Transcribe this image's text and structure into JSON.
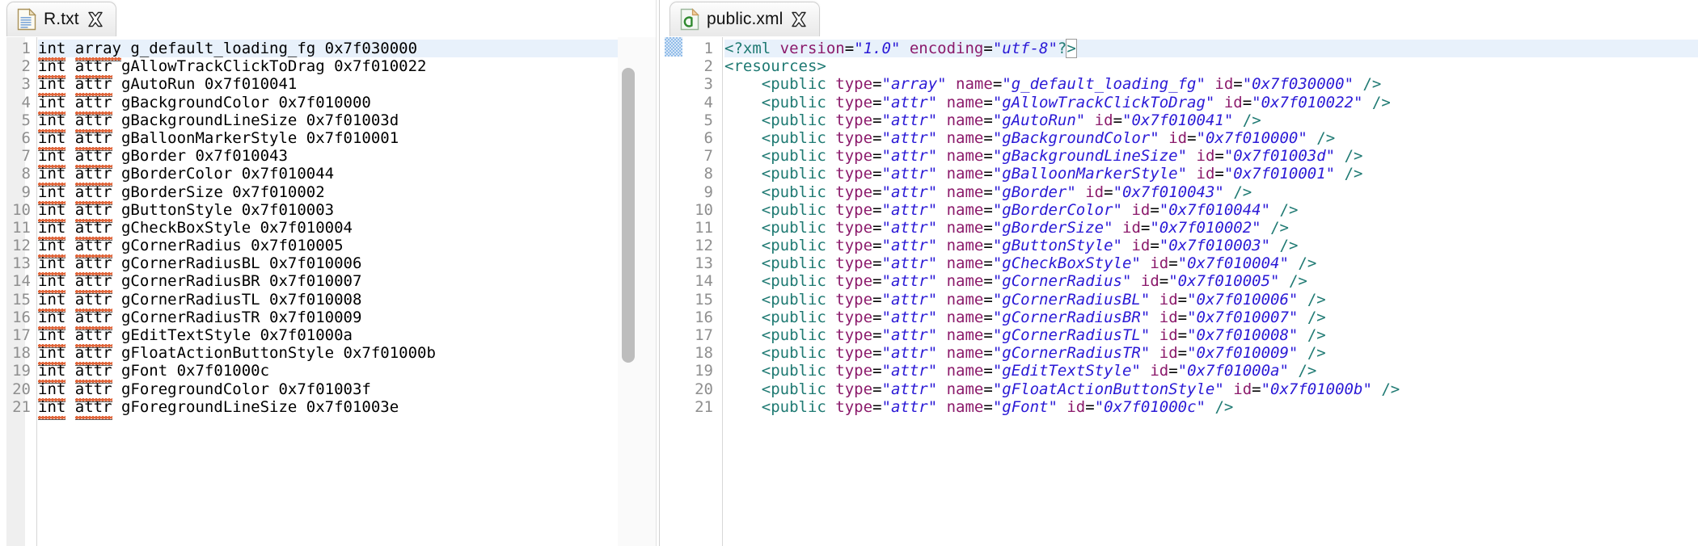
{
  "window": {
    "title": "Eclipse Editor Split View",
    "colors": {
      "tab_bg": "#f0f0f0",
      "current_line": "#e8f1fb",
      "linenumber": "#8f8f8f",
      "xml_tag": "#1f7a73",
      "xml_attr": "#8b1a6b",
      "xml_value": "#2a19d6",
      "spellcheck_underline": "#e0653a",
      "scrollbar_thumb": "#bdbdbd",
      "annotation_marker": "#7fb2e5"
    }
  },
  "left_pane": {
    "tab": {
      "label": "R.txt",
      "icon": "text-file-icon",
      "close_icon": "close-icon",
      "active": true
    },
    "scrollbar": {
      "thumb_top_pct": 6,
      "thumb_height_pct": 58
    },
    "first_line_number": 1,
    "last_line_number": 21,
    "current_line": 1,
    "lines": [
      {
        "n": 1,
        "type": "array",
        "name": "g_default_loading_fg",
        "id": "0x7f030000",
        "spell": [
          "int"
        ],
        "text": "int array g_default_loading_fg 0x7f030000"
      },
      {
        "n": 2,
        "type": "attr",
        "name": "gAllowTrackClickToDrag",
        "id": "0x7f010022",
        "spell": [
          "int",
          "attr"
        ],
        "text": "int attr gAllowTrackClickToDrag 0x7f010022"
      },
      {
        "n": 3,
        "type": "attr",
        "name": "gAutoRun",
        "id": "0x7f010041",
        "spell": [
          "int",
          "attr"
        ],
        "text": "int attr gAutoRun 0x7f010041"
      },
      {
        "n": 4,
        "type": "attr",
        "name": "gBackgroundColor",
        "id": "0x7f010000",
        "spell": [
          "int",
          "attr"
        ],
        "text": "int attr gBackgroundColor 0x7f010000"
      },
      {
        "n": 5,
        "type": "attr",
        "name": "gBackgroundLineSize",
        "id": "0x7f01003d",
        "spell": [
          "int",
          "attr"
        ],
        "text": "int attr gBackgroundLineSize 0x7f01003d"
      },
      {
        "n": 6,
        "type": "attr",
        "name": "gBalloonMarkerStyle",
        "id": "0x7f010001",
        "spell": [
          "int",
          "attr"
        ],
        "text": "int attr gBalloonMarkerStyle 0x7f010001"
      },
      {
        "n": 7,
        "type": "attr",
        "name": "gBorder",
        "id": "0x7f010043",
        "spell": [
          "int",
          "attr"
        ],
        "text": "int attr gBorder 0x7f010043"
      },
      {
        "n": 8,
        "type": "attr",
        "name": "gBorderColor",
        "id": "0x7f010044",
        "spell": [
          "int",
          "attr"
        ],
        "text": "int attr gBorderColor 0x7f010044"
      },
      {
        "n": 9,
        "type": "attr",
        "name": "gBorderSize",
        "id": "0x7f010002",
        "spell": [
          "int",
          "attr"
        ],
        "text": "int attr gBorderSize 0x7f010002"
      },
      {
        "n": 10,
        "type": "attr",
        "name": "gButtonStyle",
        "id": "0x7f010003",
        "spell": [
          "int",
          "attr"
        ],
        "text": "int attr gButtonStyle 0x7f010003"
      },
      {
        "n": 11,
        "type": "attr",
        "name": "gCheckBoxStyle",
        "id": "0x7f010004",
        "spell": [
          "int",
          "attr"
        ],
        "text": "int attr gCheckBoxStyle 0x7f010004"
      },
      {
        "n": 12,
        "type": "attr",
        "name": "gCornerRadius",
        "id": "0x7f010005",
        "spell": [
          "int",
          "attr"
        ],
        "text": "int attr gCornerRadius 0x7f010005"
      },
      {
        "n": 13,
        "type": "attr",
        "name": "gCornerRadiusBL",
        "id": "0x7f010006",
        "spell": [
          "int",
          "attr"
        ],
        "text": "int attr gCornerRadiusBL 0x7f010006"
      },
      {
        "n": 14,
        "type": "attr",
        "name": "gCornerRadiusBR",
        "id": "0x7f010007",
        "spell": [
          "int",
          "attr"
        ],
        "text": "int attr gCornerRadiusBR 0x7f010007"
      },
      {
        "n": 15,
        "type": "attr",
        "name": "gCornerRadiusTL",
        "id": "0x7f010008",
        "spell": [
          "int",
          "attr"
        ],
        "text": "int attr gCornerRadiusTL 0x7f010008"
      },
      {
        "n": 16,
        "type": "attr",
        "name": "gCornerRadiusTR",
        "id": "0x7f010009",
        "spell": [
          "int",
          "attr"
        ],
        "text": "int attr gCornerRadiusTR 0x7f010009"
      },
      {
        "n": 17,
        "type": "attr",
        "name": "gEditTextStyle",
        "id": "0x7f01000a",
        "spell": [
          "int",
          "attr"
        ],
        "text": "int attr gEditTextStyle 0x7f01000a"
      },
      {
        "n": 18,
        "type": "attr",
        "name": "gFloatActionButtonStyle",
        "id": "0x7f01000b",
        "spell": [
          "int",
          "attr"
        ],
        "text": "int attr gFloatActionButtonStyle 0x7f01000b"
      },
      {
        "n": 19,
        "type": "attr",
        "name": "gFont",
        "id": "0x7f01000c",
        "spell": [
          "int",
          "attr"
        ],
        "text": "int attr gFont 0x7f01000c"
      },
      {
        "n": 20,
        "type": "attr",
        "name": "gForegroundColor",
        "id": "0x7f01003f",
        "spell": [
          "int",
          "attr"
        ],
        "text": "int attr gForegroundColor 0x7f01003f"
      },
      {
        "n": 21,
        "type": "attr",
        "name": "gForegroundLineSize",
        "id": "0x7f01003e",
        "spell": [
          "int",
          "attr"
        ],
        "text": "int attr gForegroundLineSize 0x7f01003e"
      }
    ]
  },
  "right_pane": {
    "tab": {
      "label": "public.xml",
      "icon": "xml-file-icon",
      "close_icon": "close-icon",
      "active": true
    },
    "annotation_marker": "overview-marker",
    "first_line_number": 1,
    "last_line_number": 21,
    "current_line": 1,
    "prolog": {
      "version": "1.0",
      "encoding": "utf-8"
    },
    "root_tag": "resources",
    "lines": [
      {
        "n": 1,
        "kind": "prolog"
      },
      {
        "n": 2,
        "kind": "open-tag",
        "tag": "resources"
      },
      {
        "n": 3,
        "kind": "public",
        "type": "array",
        "name": "g_default_loading_fg",
        "id": "0x7f030000"
      },
      {
        "n": 4,
        "kind": "public",
        "type": "attr",
        "name": "gAllowTrackClickToDrag",
        "id": "0x7f010022"
      },
      {
        "n": 5,
        "kind": "public",
        "type": "attr",
        "name": "gAutoRun",
        "id": "0x7f010041"
      },
      {
        "n": 6,
        "kind": "public",
        "type": "attr",
        "name": "gBackgroundColor",
        "id": "0x7f010000"
      },
      {
        "n": 7,
        "kind": "public",
        "type": "attr",
        "name": "gBackgroundLineSize",
        "id": "0x7f01003d"
      },
      {
        "n": 8,
        "kind": "public",
        "type": "attr",
        "name": "gBalloonMarkerStyle",
        "id": "0x7f010001"
      },
      {
        "n": 9,
        "kind": "public",
        "type": "attr",
        "name": "gBorder",
        "id": "0x7f010043"
      },
      {
        "n": 10,
        "kind": "public",
        "type": "attr",
        "name": "gBorderColor",
        "id": "0x7f010044"
      },
      {
        "n": 11,
        "kind": "public",
        "type": "attr",
        "name": "gBorderSize",
        "id": "0x7f010002"
      },
      {
        "n": 12,
        "kind": "public",
        "type": "attr",
        "name": "gButtonStyle",
        "id": "0x7f010003"
      },
      {
        "n": 13,
        "kind": "public",
        "type": "attr",
        "name": "gCheckBoxStyle",
        "id": "0x7f010004"
      },
      {
        "n": 14,
        "kind": "public",
        "type": "attr",
        "name": "gCornerRadius",
        "id": "0x7f010005"
      },
      {
        "n": 15,
        "kind": "public",
        "type": "attr",
        "name": "gCornerRadiusBL",
        "id": "0x7f010006"
      },
      {
        "n": 16,
        "kind": "public",
        "type": "attr",
        "name": "gCornerRadiusBR",
        "id": "0x7f010007"
      },
      {
        "n": 17,
        "kind": "public",
        "type": "attr",
        "name": "gCornerRadiusTL",
        "id": "0x7f010008"
      },
      {
        "n": 18,
        "kind": "public",
        "type": "attr",
        "name": "gCornerRadiusTR",
        "id": "0x7f010009"
      },
      {
        "n": 19,
        "kind": "public",
        "type": "attr",
        "name": "gEditTextStyle",
        "id": "0x7f01000a"
      },
      {
        "n": 20,
        "kind": "public",
        "type": "attr",
        "name": "gFloatActionButtonStyle",
        "id": "0x7f01000b"
      },
      {
        "n": 21,
        "kind": "public",
        "type": "attr",
        "name": "gFont",
        "id": "0x7f01000c"
      }
    ]
  }
}
